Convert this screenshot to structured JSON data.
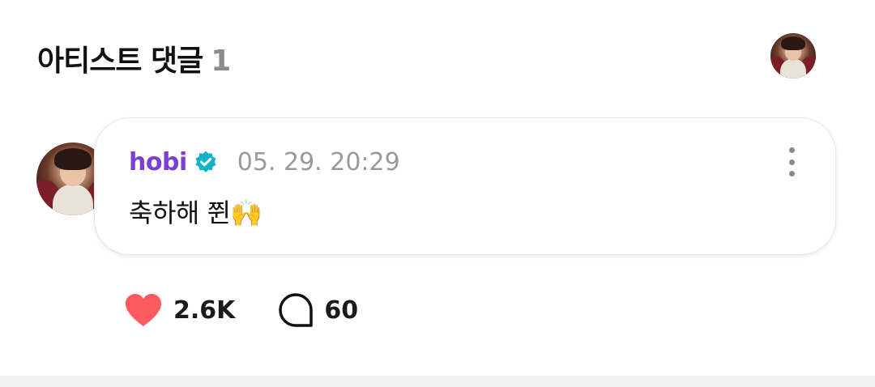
{
  "header": {
    "title": "아티스트 댓글",
    "count": "1",
    "avatar_icon": "artist-avatar-icon"
  },
  "comment": {
    "author": "hobi",
    "verified_icon": "verified-badge-icon",
    "timestamp": "05. 29. 20:29",
    "text": "축하해 쮠🙌",
    "more_icon": "more-vertical-icon"
  },
  "actions": {
    "like_icon": "heart-icon",
    "like_count": "2.6K",
    "reply_icon": "speech-bubble-icon",
    "reply_count": "60"
  },
  "colors": {
    "author": "#7b3fd6",
    "verified": "#12b3c6",
    "heart": "#ff5a5f",
    "muted": "#9a9a9a"
  }
}
